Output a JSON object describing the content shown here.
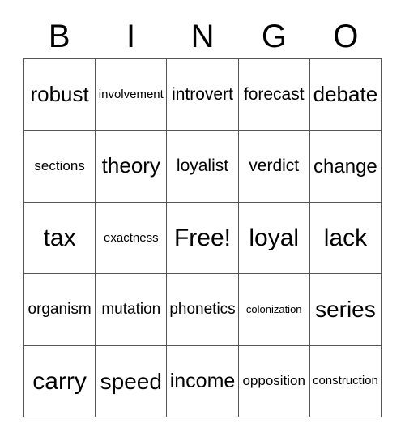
{
  "card": {
    "title": "Bingo Card",
    "header_letters": [
      "B",
      "I",
      "N",
      "G",
      "O"
    ],
    "columns": 5,
    "rows": 5,
    "free_space_label": "Free!",
    "free_space_position": {
      "row": 3,
      "column": 3
    },
    "border_color": "#555555",
    "background_color": "#ffffff",
    "text_color": "#000000",
    "grid": [
      [
        {
          "text": "robust",
          "size": "md"
        },
        {
          "text": "involvement",
          "size": "tiny"
        },
        {
          "text": "introvert",
          "size": "sm"
        },
        {
          "text": "forecast",
          "size": "sm"
        },
        {
          "text": "debate",
          "size": "md"
        }
      ],
      [
        {
          "text": "sections",
          "size": "xxs"
        },
        {
          "text": "theory",
          "size": "md"
        },
        {
          "text": "loyalist",
          "size": "sm"
        },
        {
          "text": "verdict",
          "size": "sm"
        },
        {
          "text": "change",
          "size": "md"
        }
      ],
      [
        {
          "text": "tax",
          "size": "xl"
        },
        {
          "text": "exactness",
          "size": "tiny"
        },
        {
          "text": "Free!",
          "size": "xl"
        },
        {
          "text": "loyal",
          "size": "xl"
        },
        {
          "text": "lack",
          "size": "xl"
        }
      ],
      [
        {
          "text": "organism",
          "size": "xs"
        },
        {
          "text": "mutation",
          "size": "xs"
        },
        {
          "text": "phonetics",
          "size": "xs"
        },
        {
          "text": "colonization",
          "size": "micro"
        },
        {
          "text": "series",
          "size": "lg"
        }
      ],
      [
        {
          "text": "carry",
          "size": "xl"
        },
        {
          "text": "speed",
          "size": "lg"
        },
        {
          "text": "income",
          "size": "lg"
        },
        {
          "text": "opposition",
          "size": "xxs"
        },
        {
          "text": "construction",
          "size": "tiny"
        }
      ]
    ]
  }
}
